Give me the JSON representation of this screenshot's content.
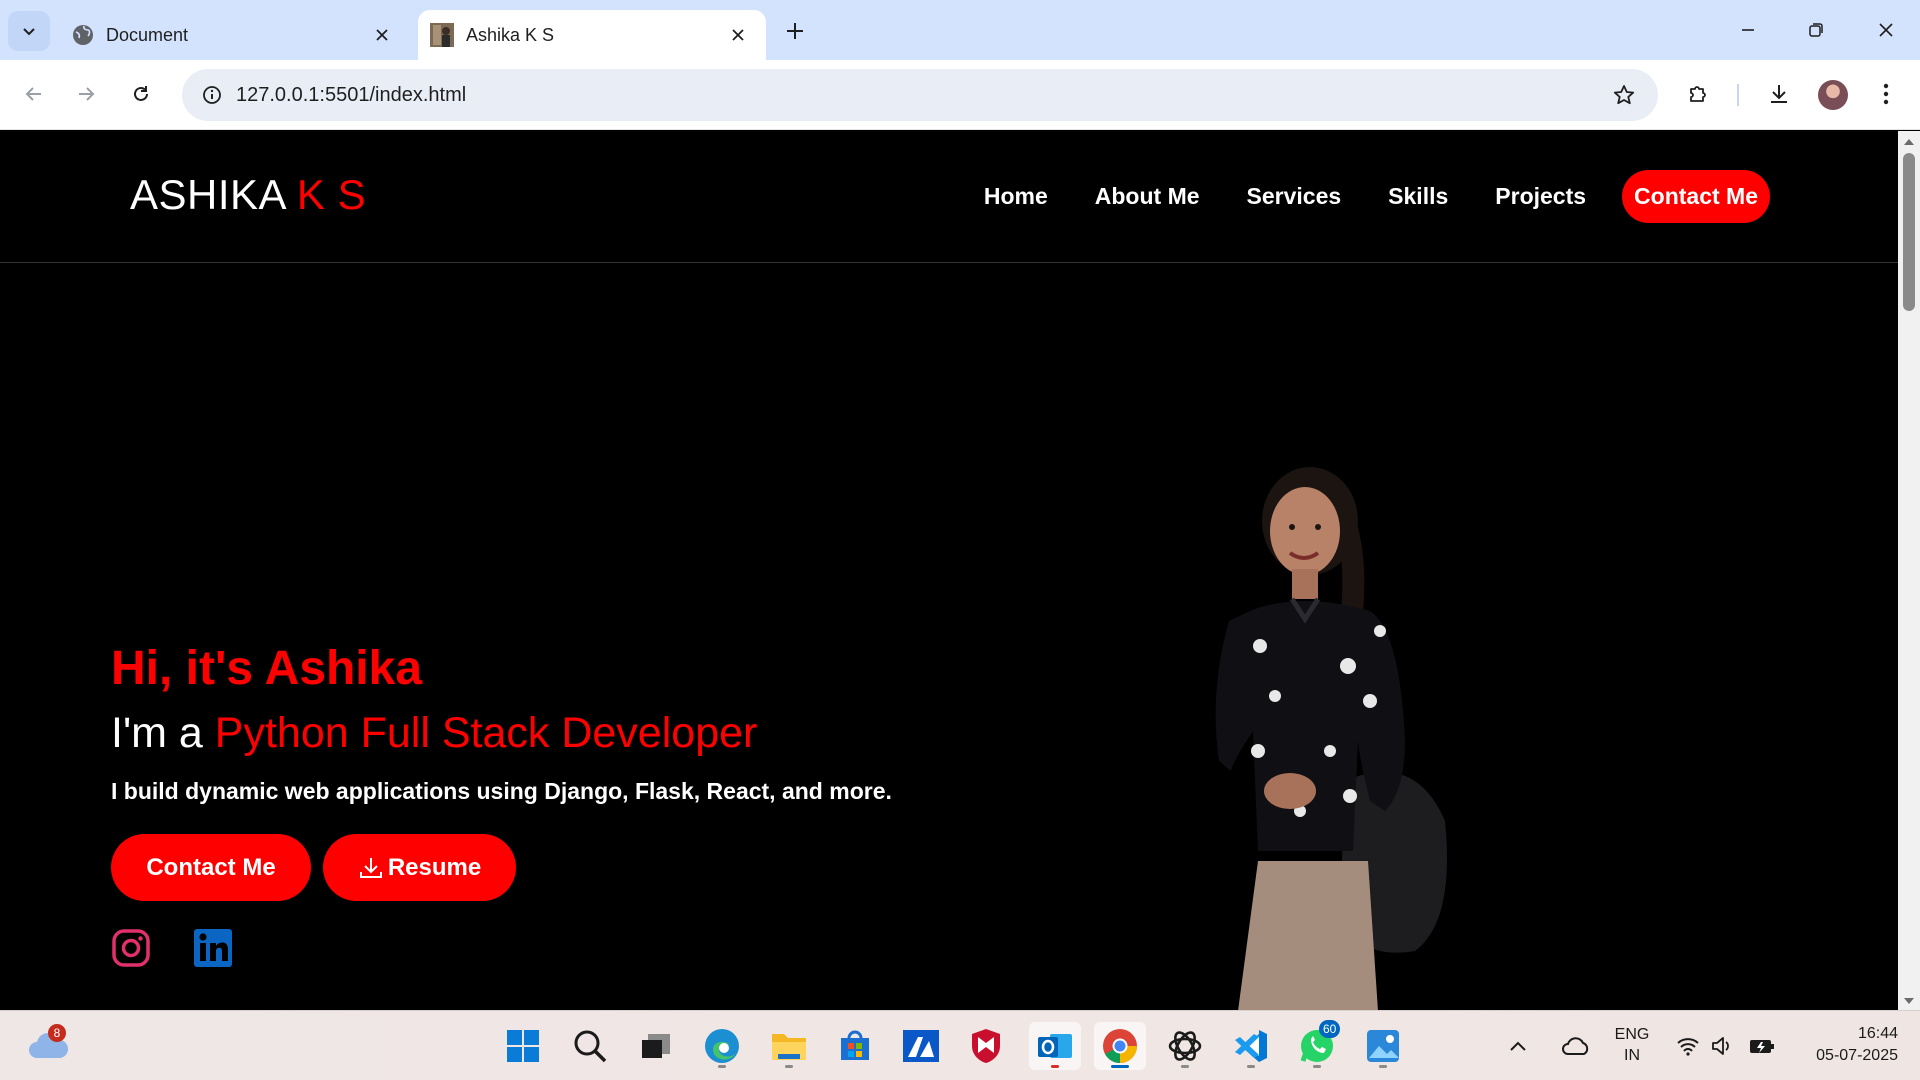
{
  "browser": {
    "tabs": [
      {
        "title": "Document",
        "active": false
      },
      {
        "title": "Ashika K S",
        "active": true
      }
    ],
    "url": "127.0.0.1:5501/index.html"
  },
  "site": {
    "logo": {
      "main": "ASHIKA",
      "accent": "K S"
    },
    "nav": [
      "Home",
      "About Me",
      "Services",
      "Skills",
      "Projects"
    ],
    "nav_cta": "Contact Me",
    "hero": {
      "greeting": "Hi, it's Ashika",
      "role_prefix": "I'm a",
      "role": "Python Full Stack Developer",
      "description": "I build dynamic web applications using Django, Flask, React, and more.",
      "buttons": {
        "contact": "Contact Me",
        "resume": "Resume"
      }
    },
    "social": [
      "instagram-icon",
      "linkedin-icon"
    ],
    "accent_color": "#ff0000"
  },
  "taskbar": {
    "weather_badge": "8",
    "whatsapp_badge": "60",
    "language": {
      "line1": "ENG",
      "line2": "IN"
    },
    "time": "16:44",
    "date": "05-07-2025"
  }
}
